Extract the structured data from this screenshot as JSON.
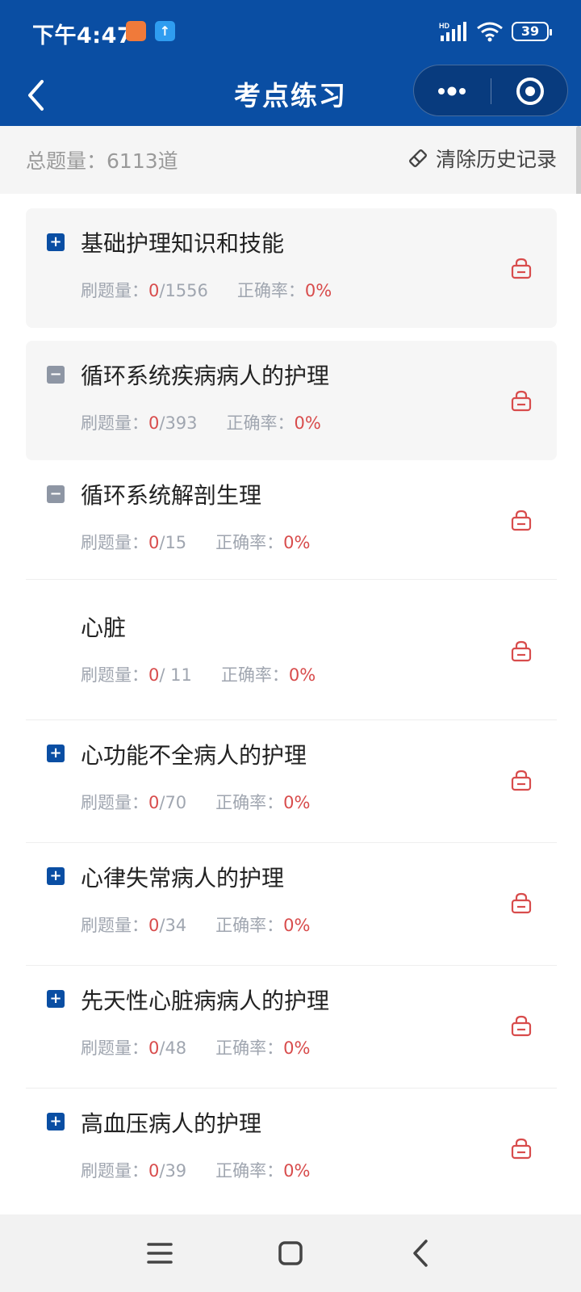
{
  "status_bar": {
    "time": "下午4:47",
    "battery": "39",
    "signal_label": "HD"
  },
  "nav": {
    "title": "考点练习",
    "more_icon": "more-dots-icon",
    "close_icon": "target-circle-icon",
    "back_icon": "chevron-left-icon"
  },
  "summary": {
    "total_label": "总题量：",
    "total_value": "6113道",
    "clear_label": "清除历史记录",
    "clear_icon": "eraser-icon"
  },
  "labels": {
    "progress": "刷题量：",
    "accuracy": "正确率："
  },
  "items": [
    {
      "title": "基础护理知识和技能",
      "expander": "+",
      "done": "0",
      "total": "/1556",
      "accuracy": "0%"
    },
    {
      "title": "循环系统疾病病人的护理",
      "expander": "−",
      "done": "0",
      "total": "/393",
      "accuracy": "0%"
    },
    {
      "title": "循环系统解剖生理",
      "expander": "−",
      "done": "0",
      "total": "/15",
      "accuracy": "0%"
    },
    {
      "title": "心脏",
      "expander": "",
      "done": "0",
      "total": "/ 11",
      "accuracy": "0%"
    },
    {
      "title": "心功能不全病人的护理",
      "expander": "+",
      "done": "0",
      "total": "/70",
      "accuracy": "0%"
    },
    {
      "title": "心律失常病人的护理",
      "expander": "+",
      "done": "0",
      "total": "/34",
      "accuracy": "0%"
    },
    {
      "title": "先天性心脏病病人的护理",
      "expander": "+",
      "done": "0",
      "total": "/48",
      "accuracy": "0%"
    },
    {
      "title": "高血压病人的护理",
      "expander": "+",
      "done": "0",
      "total": "/39",
      "accuracy": "0%"
    }
  ],
  "colors": {
    "header": "#0a4ea3",
    "accent_red": "#d84c4c",
    "muted": "#a0a6b0"
  },
  "system_nav": {
    "menu_icon": "menu-lines-icon",
    "home_icon": "square-home-icon",
    "back_icon": "triangle-back-icon"
  }
}
